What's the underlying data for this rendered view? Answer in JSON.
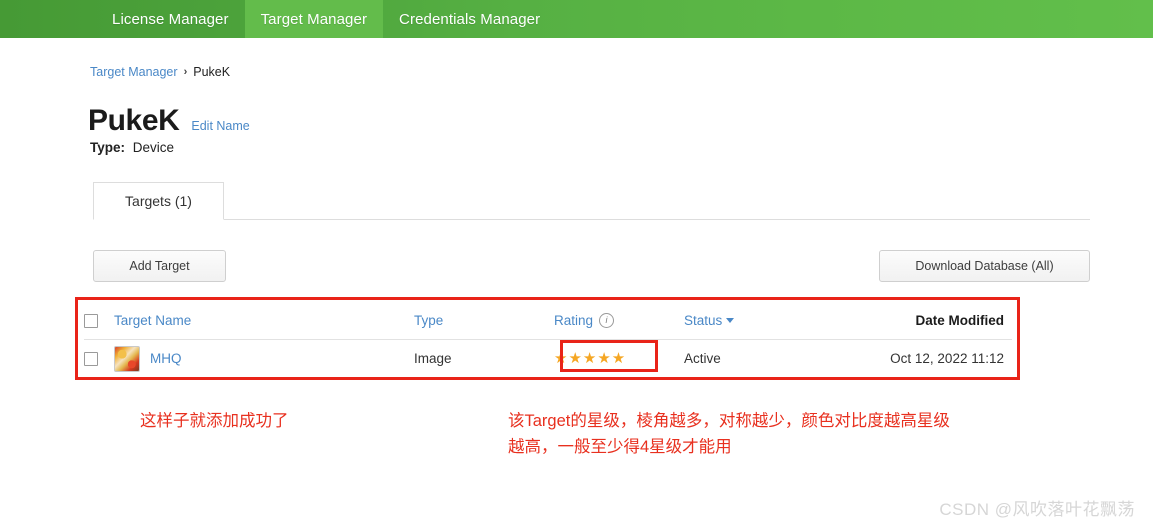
{
  "navbar": {
    "items": [
      {
        "label": "License Manager",
        "active": false
      },
      {
        "label": "Target Manager",
        "active": true
      },
      {
        "label": "Credentials Manager",
        "active": false
      }
    ]
  },
  "breadcrumb": {
    "parent": "Target Manager",
    "separator": "›",
    "current": "PukeK"
  },
  "header": {
    "title": "PukeK",
    "edit_name_label": "Edit Name",
    "type_label": "Type:",
    "type_value": "Device"
  },
  "tabs": [
    {
      "label": "Targets (1)",
      "active": true
    }
  ],
  "toolbar": {
    "add_target_label": "Add Target",
    "download_db_label": "Download Database (All)"
  },
  "table": {
    "columns": [
      {
        "label": "Target Name",
        "style": "link"
      },
      {
        "label": "Type",
        "style": "link"
      },
      {
        "label": "Rating",
        "style": "link",
        "icon": "info-icon"
      },
      {
        "label": "Status",
        "style": "link",
        "icon": "chevron-down-icon"
      },
      {
        "label": "Date Modified",
        "style": "plain"
      }
    ],
    "rows": [
      {
        "name": "MHQ",
        "type": "Image",
        "rating": 5,
        "rating_stars": "★★★★★",
        "status": "Active",
        "date_modified": "Oct 12, 2022 11:12"
      }
    ]
  },
  "annotations": {
    "left": "这样子就添加成功了",
    "right": "该Target的星级，棱角越多，对称越少，颜色对比度越高星级\n越高，一般至少得4星级才能用"
  },
  "watermark": {
    "text": "CSDN @风吹落叶花飘荡"
  },
  "colors": {
    "nav_green_dark": "#469a35",
    "nav_green_light": "#62bf4b",
    "nav_active": "#63bc4b",
    "link_blue": "#4a88c7",
    "annotation_red": "#e8301f",
    "highlight_red": "#e92318",
    "star_gold": "#f5a623"
  }
}
